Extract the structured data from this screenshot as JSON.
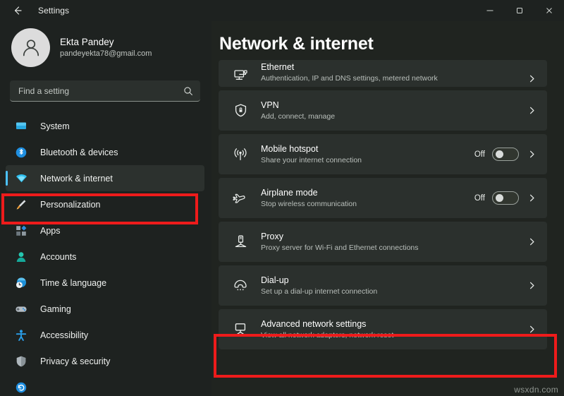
{
  "window": {
    "title": "Settings",
    "back_icon": "back-arrow-icon",
    "controls": {
      "minimize": "minimize-icon",
      "maximize": "maximize-icon",
      "close": "close-icon"
    }
  },
  "account": {
    "name": "Ekta Pandey",
    "email": "pandeyekta78@gmail.com",
    "avatar_icon": "person-avatar-icon"
  },
  "search": {
    "placeholder": "Find a setting",
    "value": "",
    "icon": "search-icon"
  },
  "sidebar": {
    "items": [
      {
        "label": "System",
        "icon": "system-monitor-icon",
        "selected": false
      },
      {
        "label": "Bluetooth & devices",
        "icon": "bluetooth-icon",
        "selected": false
      },
      {
        "label": "Network & internet",
        "icon": "wifi-icon",
        "selected": true
      },
      {
        "label": "Personalization",
        "icon": "paintbrush-icon",
        "selected": false
      },
      {
        "label": "Apps",
        "icon": "apps-icon",
        "selected": false
      },
      {
        "label": "Accounts",
        "icon": "account-person-icon",
        "selected": false
      },
      {
        "label": "Time & language",
        "icon": "clock-globe-icon",
        "selected": false
      },
      {
        "label": "Gaming",
        "icon": "gamepad-icon",
        "selected": false
      },
      {
        "label": "Accessibility",
        "icon": "accessibility-person-icon",
        "selected": false
      },
      {
        "label": "Privacy & security",
        "icon": "shield-icon",
        "selected": false
      },
      {
        "label": "",
        "icon": "windows-update-icon",
        "selected": false
      }
    ]
  },
  "main": {
    "title": "Network & internet",
    "cards": [
      {
        "title": "Ethernet",
        "subtitle": "Authentication, IP and DNS settings, metered network",
        "icon": "ethernet-icon",
        "toggle": null,
        "chevron": "chevron-right-icon",
        "clipped": true,
        "highlighted": false
      },
      {
        "title": "VPN",
        "subtitle": "Add, connect, manage",
        "icon": "vpn-shield-lock-icon",
        "toggle": null,
        "chevron": "chevron-right-icon",
        "clipped": false,
        "highlighted": false
      },
      {
        "title": "Mobile hotspot",
        "subtitle": "Share your internet connection",
        "icon": "hotspot-broadcast-icon",
        "toggle": {
          "state_label": "Off",
          "on": false
        },
        "chevron": "chevron-right-icon",
        "clipped": false,
        "highlighted": false
      },
      {
        "title": "Airplane mode",
        "subtitle": "Stop wireless communication",
        "icon": "airplane-icon",
        "toggle": {
          "state_label": "Off",
          "on": false
        },
        "chevron": "chevron-right-icon",
        "clipped": false,
        "highlighted": false
      },
      {
        "title": "Proxy",
        "subtitle": "Proxy server for Wi-Fi and Ethernet connections",
        "icon": "proxy-server-icon",
        "toggle": null,
        "chevron": "chevron-right-icon",
        "clipped": false,
        "highlighted": false
      },
      {
        "title": "Dial-up",
        "subtitle": "Set up a dial-up internet connection",
        "icon": "dialup-phone-icon",
        "toggle": null,
        "chevron": "chevron-right-icon",
        "clipped": false,
        "highlighted": false
      },
      {
        "title": "Advanced network settings",
        "subtitle": "View all network adapters, network reset",
        "icon": "advanced-network-icon",
        "toggle": null,
        "chevron": "chevron-right-icon",
        "clipped": false,
        "highlighted": true
      }
    ]
  },
  "annotations": {
    "highlight_color": "#ee1b1b",
    "boxes": [
      {
        "name": "sidebar-network-highlight"
      },
      {
        "name": "advanced-network-settings-highlight"
      }
    ]
  },
  "watermark": "wsxdn.com",
  "colors": {
    "window_bg": "#202420",
    "sidebar_bg": "#1e2220",
    "card_bg": "#2b302d",
    "accent": "#4cc2ff",
    "annotation": "#ee1b1b"
  }
}
